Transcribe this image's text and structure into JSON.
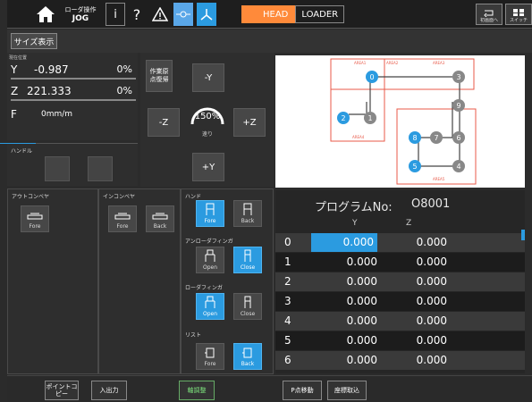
{
  "topbar": {
    "mode_line1": "ローダ操作",
    "mode_line2": "JOG",
    "tabs": [
      "HEAD",
      "LOADER"
    ],
    "right_btn1": "初画面へ",
    "right_btn2": "スイッチ"
  },
  "toolbar": {
    "size_button": "サイズ表示"
  },
  "coords": {
    "title": "現在位置",
    "rows": [
      {
        "axis": "Y",
        "value": "-0.987",
        "pct": "0%"
      },
      {
        "axis": "Z",
        "value": "221.333",
        "pct": "0%"
      },
      {
        "axis": "F",
        "value": "0mm/m",
        "pct": ""
      }
    ]
  },
  "handle": {
    "title": "ハンドル"
  },
  "jog": {
    "origin_label": "作業原点復帰",
    "minus_y": "-Y",
    "minus_z": "-Z",
    "plus_z": "+Z",
    "plus_y": "+Y",
    "speed": "150%",
    "speed_label": "速り"
  },
  "diagram": {
    "area_labels": [
      "AREA1",
      "AREA2",
      "AREA3",
      "AREA4",
      "AREA5"
    ],
    "nodes": [
      "0",
      "1",
      "2",
      "3",
      "4",
      "5",
      "6",
      "7",
      "8",
      "9"
    ]
  },
  "out_conveyor": {
    "title": "アウトコンベヤ",
    "fore": "Fore"
  },
  "in_conveyor": {
    "title": "インコンベヤ",
    "fore": "Fore",
    "back": "Back"
  },
  "hand": {
    "title": "ハンド",
    "fore": "Fore",
    "back": "Back"
  },
  "unloader_finger": {
    "title": "アンローダフィンガ",
    "open": "Open",
    "close": "Close"
  },
  "loader_finger": {
    "title": "ローダフィンガ",
    "open": "Open",
    "close": "Close"
  },
  "wrist": {
    "title": "リスト",
    "fore": "Fore",
    "back": "Back"
  },
  "program": {
    "title": "プログラムNo:",
    "number": "O8001",
    "col_y": "Y",
    "col_z": "Z",
    "rows": [
      {
        "idx": "0",
        "y": "0.000",
        "z": "0.000"
      },
      {
        "idx": "1",
        "y": "0.000",
        "z": "0.000"
      },
      {
        "idx": "2",
        "y": "0.000",
        "z": "0.000"
      },
      {
        "idx": "3",
        "y": "0.000",
        "z": "0.000"
      },
      {
        "idx": "4",
        "y": "0.000",
        "z": "0.000"
      },
      {
        "idx": "5",
        "y": "0.000",
        "z": "0.000"
      },
      {
        "idx": "6",
        "y": "0.000",
        "z": "0.000"
      }
    ]
  },
  "bottombar": {
    "point_copy": "ポイントコピー",
    "io": "入出力",
    "axis_adjust": "軸調整",
    "p_move": "P点移動",
    "coord_get": "座標取込"
  },
  "colors": {
    "accent_orange": "#ff8a3a",
    "accent_blue": "#2b9be0",
    "diagram_red": "#e85a4a"
  }
}
